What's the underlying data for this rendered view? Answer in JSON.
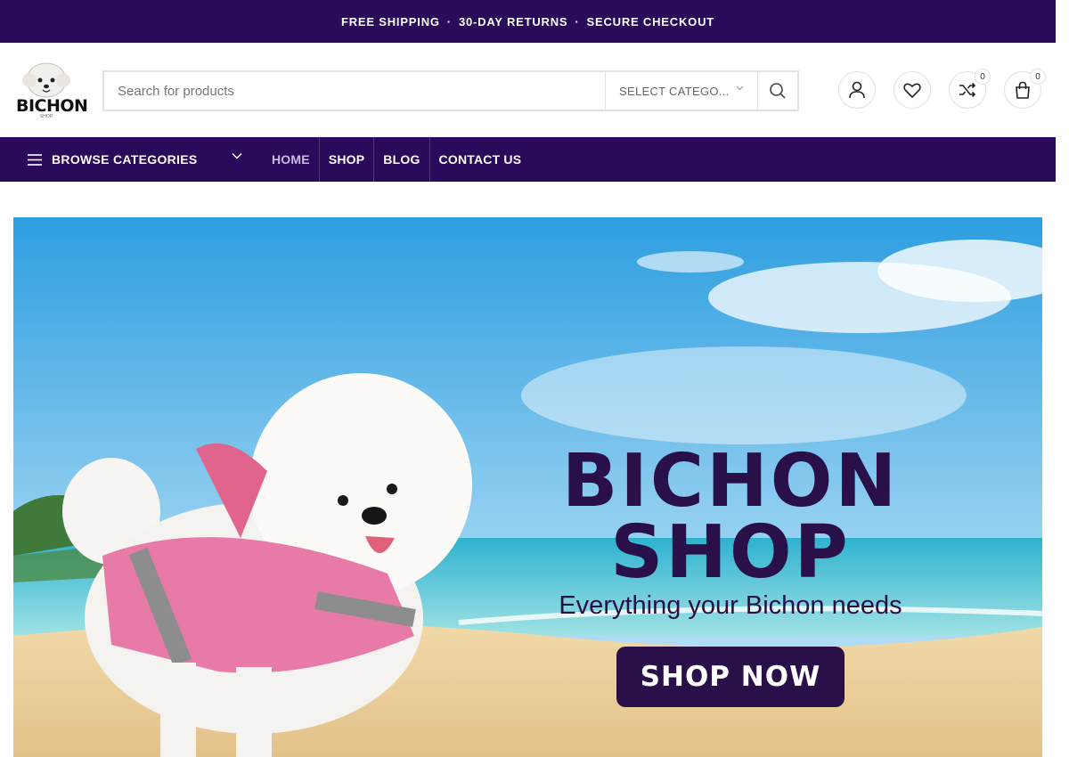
{
  "topbar": {
    "items": [
      "FREE SHIPPING",
      "30-DAY RETURNS",
      "SECURE CHECKOUT"
    ],
    "separator": "·"
  },
  "header": {
    "logo_text": "BICHON",
    "logo_subtext": "SHOP",
    "search_placeholder": "Search for products",
    "category_select": "SELECT CATEGO...",
    "compare_count": "0",
    "cart_count": "0"
  },
  "nav": {
    "browse_label": "BROWSE CATEGORIES",
    "items": [
      "HOME",
      "SHOP",
      "BLOG",
      "CONTACT US"
    ]
  },
  "hero": {
    "title_line1": "BICHON",
    "title_line2": "SHOP",
    "subtitle": "Everything your Bichon needs",
    "button_label": "SHOP NOW"
  },
  "colors": {
    "brand": "#2a0a5a",
    "hero_text": "#2a1048"
  },
  "icons": [
    "search-icon",
    "chevron-down-icon",
    "user-icon",
    "heart-icon",
    "shuffle-icon",
    "shopping-bag-icon",
    "menu-icon"
  ]
}
